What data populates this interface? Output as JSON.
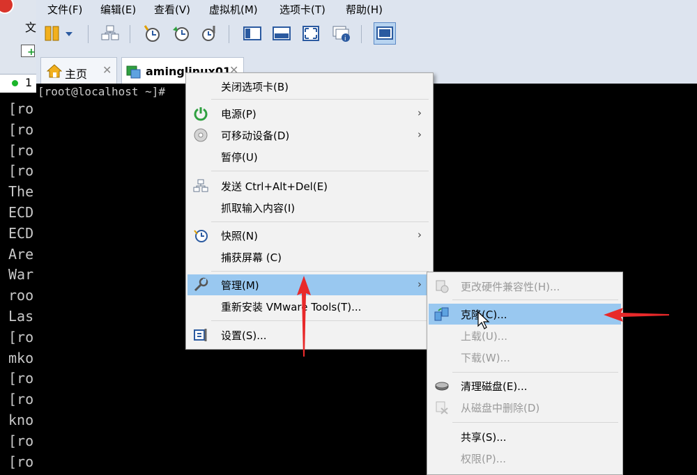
{
  "background_window": {
    "menu_fragment": "文",
    "status_number": "1",
    "terminal_lines": [
      "[ro",
      "[ro",
      "[ro",
      "[ro",
      "The",
      "ECD",
      "ECD",
      "Are",
      "War",
      "roo",
      "Las",
      "[ro",
      "mko",
      "[ro",
      "[ro",
      "kno",
      "[ro",
      "[ro"
    ]
  },
  "menubar": {
    "items": [
      "文件(F)",
      "编辑(E)",
      "查看(V)",
      "虚拟机(M)",
      "选项卡(T)",
      "帮助(H)"
    ]
  },
  "toolbar": {
    "buttons": [
      "pause-icon",
      "dropdown-arrow-icon",
      "send-ctrl-alt-del-icon",
      "snapshot-icon",
      "revert-snapshot-icon",
      "snapshot-manager-icon",
      "console-view-icon",
      "fullscreen-icon",
      "fit-window-icon",
      "unity-icon",
      "library-icon"
    ]
  },
  "tabs": [
    {
      "label": "主页",
      "close": "✕"
    },
    {
      "label": "aminglinux01",
      "close": "✕"
    }
  ],
  "terminal": {
    "prompt": "[root@localhost ~]#"
  },
  "context_menu": {
    "items": [
      {
        "label": "关闭选项卡(B)"
      },
      {
        "label": "电源(P)",
        "arrow": "›"
      },
      {
        "label": "可移动设备(D)",
        "arrow": "›"
      },
      {
        "label": "暂停(U)"
      },
      {
        "label": "发送 Ctrl+Alt+Del(E)"
      },
      {
        "label": "抓取输入内容(I)"
      },
      {
        "label": "快照(N)",
        "arrow": "›"
      },
      {
        "label": "捕获屏幕 (C)"
      },
      {
        "label": "管理(M)",
        "arrow": "›"
      },
      {
        "label": "重新安装 VMware Tools(T)..."
      },
      {
        "label": "设置(S)..."
      }
    ]
  },
  "submenu": {
    "items": [
      {
        "label": "更改硬件兼容性(H)...",
        "enabled": false
      },
      {
        "label": "克隆(C)...",
        "enabled": true
      },
      {
        "label": "上载(U)...",
        "enabled": false
      },
      {
        "label": "下载(W)...",
        "enabled": false
      },
      {
        "label": "清理磁盘(E)...",
        "enabled": true
      },
      {
        "label": "从磁盘中删除(D)",
        "enabled": false
      },
      {
        "label": "共享(S)...",
        "enabled": true
      },
      {
        "label": "权限(P)...",
        "enabled": false
      }
    ]
  },
  "colors": {
    "highlight": "#99c8f0",
    "annotation": "#e8292a",
    "chrome": "#dde4ef"
  }
}
